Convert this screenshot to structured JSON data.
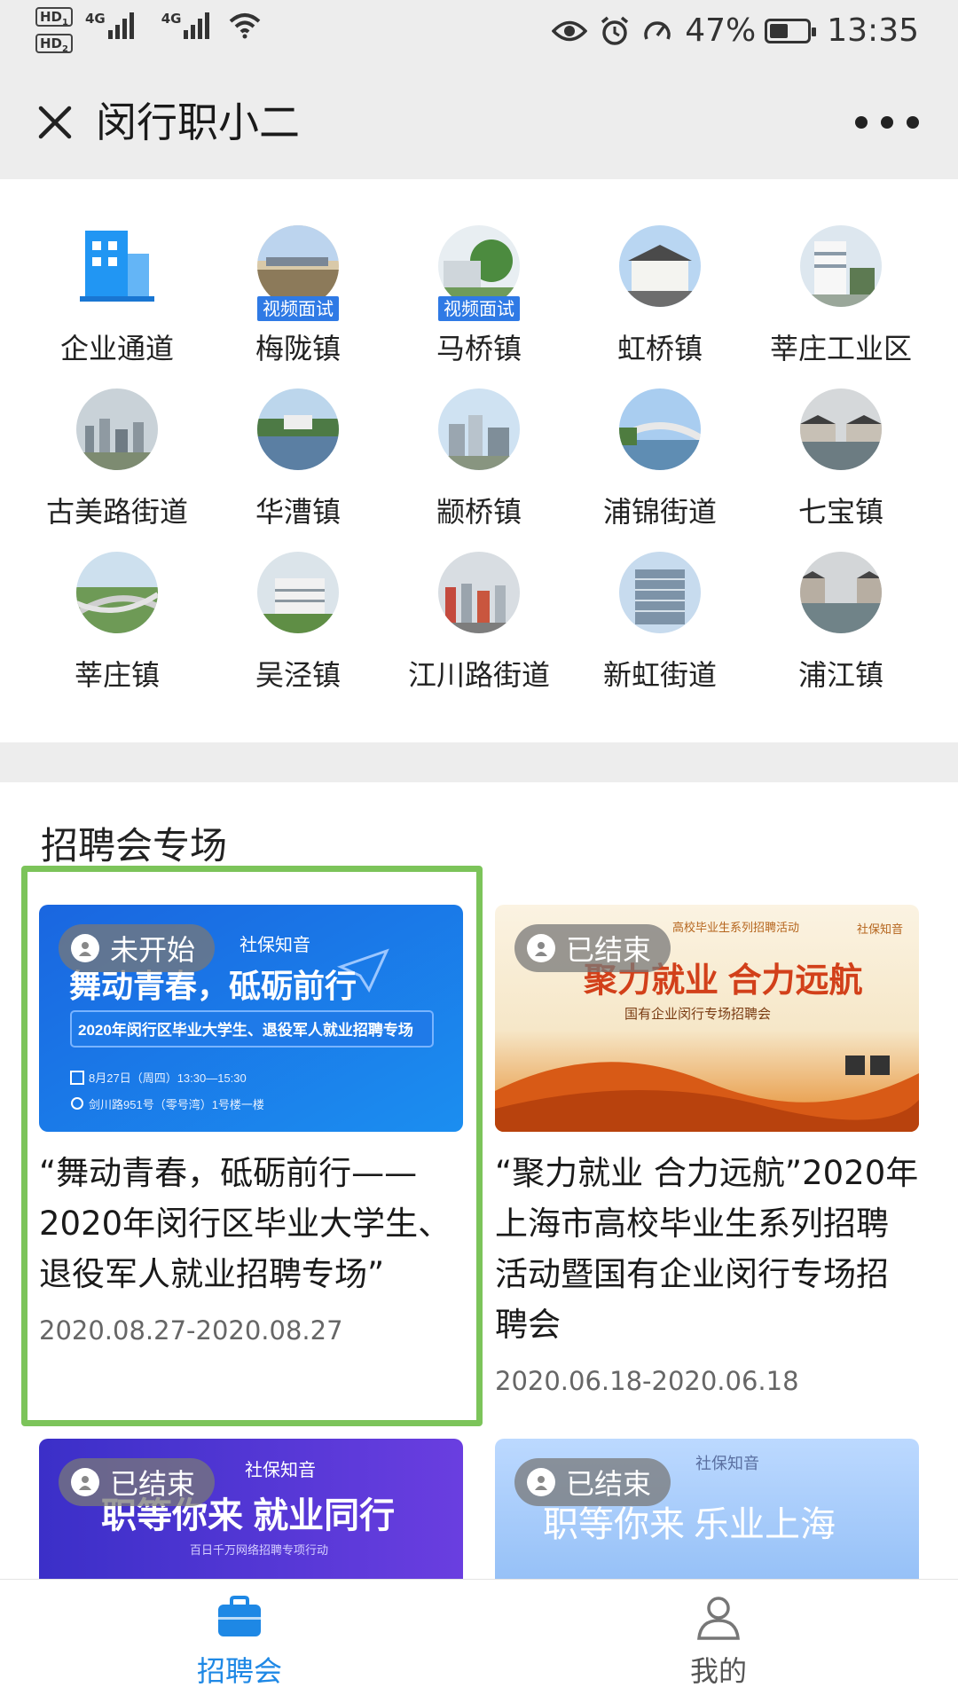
{
  "status_bar": {
    "sim1": "HD",
    "sim1_index": "1",
    "sim2": "HD",
    "sim2_index": "2",
    "net1": "4G",
    "net2": "4G",
    "battery_percent": "47%",
    "time": "13:35",
    "icons": [
      "eye-icon",
      "alarm-icon",
      "speed-icon",
      "battery-icon",
      "wifi-icon",
      "signal-icon"
    ]
  },
  "header": {
    "title": "闵行职小二",
    "close_icon": "close-icon",
    "more_icon": "more-icon"
  },
  "grid": {
    "items": [
      {
        "label": "企业通道",
        "icon": "building-icon"
      },
      {
        "label": "梅陇镇",
        "badge": "视频面试"
      },
      {
        "label": "马桥镇",
        "badge": "视频面试"
      },
      {
        "label": "虹桥镇"
      },
      {
        "label": "莘庄工业区"
      },
      {
        "label": "古美路街道"
      },
      {
        "label": "华漕镇"
      },
      {
        "label": "颛桥镇"
      },
      {
        "label": "浦锦街道"
      },
      {
        "label": "七宝镇"
      },
      {
        "label": "莘庄镇"
      },
      {
        "label": "吴泾镇"
      },
      {
        "label": "江川路街道"
      },
      {
        "label": "新虹街道"
      },
      {
        "label": "浦江镇"
      }
    ]
  },
  "recruit": {
    "section_title": "招聘会专场",
    "cards": [
      {
        "status": "未开始",
        "title": "“舞动青春，砥砺前行——2020年闵行区毕业大学生、退役军人就业招聘专场”",
        "date": "2020.08.27-2020.08.27",
        "banner_brand": "社保知音",
        "banner_headline": "舞动青春，砥砺前行",
        "banner_sub": "2020年闵行区毕业大学生、退役军人就业招聘专场",
        "banner_time": "8月27日（周四）13:30—15:30",
        "banner_place": "剑川路951号（零号湾）1号楼一楼"
      },
      {
        "status": "已结束",
        "title": "“聚力就业 合力远航”2020年上海市高校毕业生系列招聘活动暨国有企业闵行专场招聘会",
        "date": "2020.06.18-2020.06.18",
        "banner_brand": "社保知音",
        "banner_top": "高校毕业生系列招聘活动",
        "banner_headline": "聚力就业 合力远航",
        "banner_sub": "国有企业闵行专场招聘会"
      },
      {
        "status": "已结束",
        "banner_brand": "社保知音",
        "banner_headline": "职等你来 就业同行",
        "banner_sub": "百日千万网络招聘专项行动"
      },
      {
        "status": "已结束",
        "banner_brand": "社保知音",
        "banner_headline": "职等你来 乐业上海"
      }
    ]
  },
  "bottom_nav": {
    "items": [
      {
        "label": "招聘会",
        "icon": "briefcase-icon",
        "active": true,
        "color": "#1e88e5"
      },
      {
        "label": "我的",
        "icon": "person-icon",
        "active": false,
        "color": "#666666"
      }
    ]
  }
}
